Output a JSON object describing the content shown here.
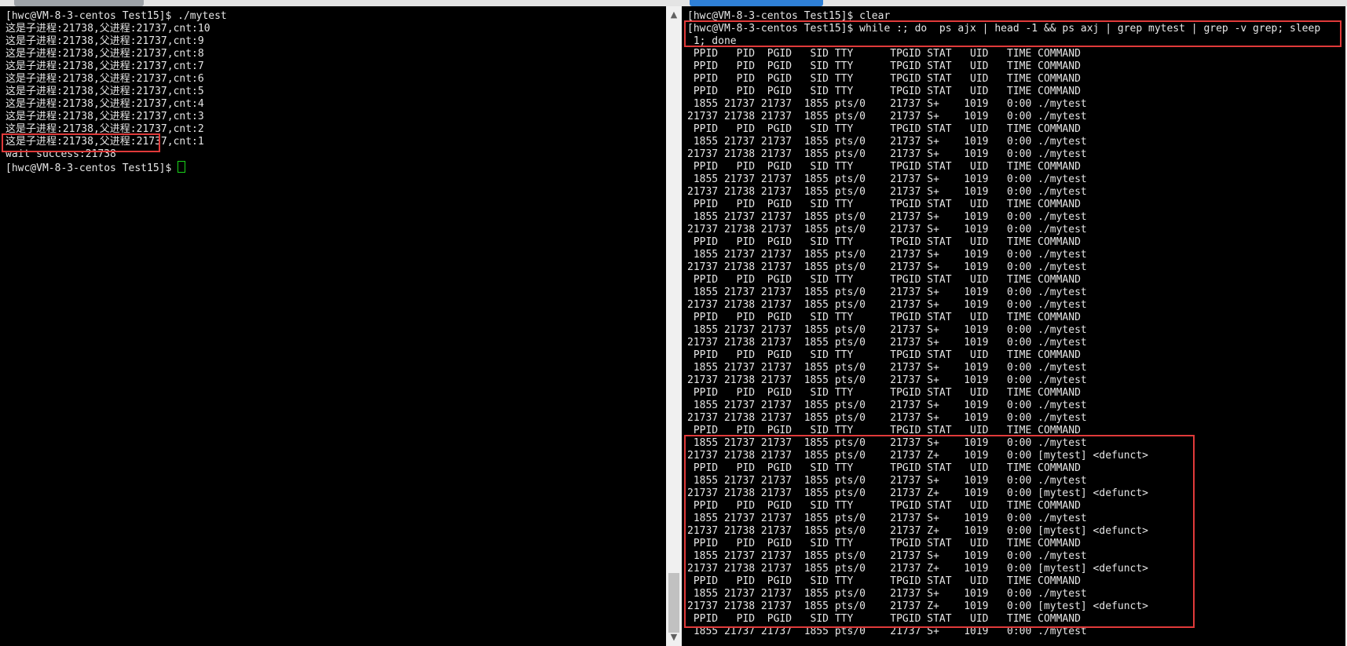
{
  "left_terminal": {
    "lines": [
      "[hwc@VM-8-3-centos Test15]$ ./mytest",
      "这是子进程:21738,父进程:21737,cnt:10",
      "这是子进程:21738,父进程:21737,cnt:9",
      "这是子进程:21738,父进程:21737,cnt:8",
      "这是子进程:21738,父进程:21737,cnt:7",
      "这是子进程:21738,父进程:21737,cnt:6",
      "这是子进程:21738,父进程:21737,cnt:5",
      "这是子进程:21738,父进程:21737,cnt:4",
      "这是子进程:21738,父进程:21737,cnt:3",
      "这是子进程:21738,父进程:21737,cnt:2",
      "这是子进程:21738,父进程:21737,cnt:1",
      "wait success:21738"
    ],
    "prompt": "[hwc@VM-8-3-centos Test15]$ "
  },
  "right_terminal": {
    "lines": [
      "[hwc@VM-8-3-centos Test15]$ clear",
      "[hwc@VM-8-3-centos Test15]$ while :; do  ps ajx | head -1 && ps axj | grep mytest | grep -v grep; sleep",
      " 1; done",
      " PPID   PID  PGID   SID TTY      TPGID STAT   UID   TIME COMMAND",
      " PPID   PID  PGID   SID TTY      TPGID STAT   UID   TIME COMMAND",
      " PPID   PID  PGID   SID TTY      TPGID STAT   UID   TIME COMMAND",
      " PPID   PID  PGID   SID TTY      TPGID STAT   UID   TIME COMMAND",
      " 1855 21737 21737  1855 pts/0    21737 S+    1019   0:00 ./mytest",
      "21737 21738 21737  1855 pts/0    21737 S+    1019   0:00 ./mytest",
      " PPID   PID  PGID   SID TTY      TPGID STAT   UID   TIME COMMAND",
      " 1855 21737 21737  1855 pts/0    21737 S+    1019   0:00 ./mytest",
      "21737 21738 21737  1855 pts/0    21737 S+    1019   0:00 ./mytest",
      " PPID   PID  PGID   SID TTY      TPGID STAT   UID   TIME COMMAND",
      " 1855 21737 21737  1855 pts/0    21737 S+    1019   0:00 ./mytest",
      "21737 21738 21737  1855 pts/0    21737 S+    1019   0:00 ./mytest",
      " PPID   PID  PGID   SID TTY      TPGID STAT   UID   TIME COMMAND",
      " 1855 21737 21737  1855 pts/0    21737 S+    1019   0:00 ./mytest",
      "21737 21738 21737  1855 pts/0    21737 S+    1019   0:00 ./mytest",
      " PPID   PID  PGID   SID TTY      TPGID STAT   UID   TIME COMMAND",
      " 1855 21737 21737  1855 pts/0    21737 S+    1019   0:00 ./mytest",
      "21737 21738 21737  1855 pts/0    21737 S+    1019   0:00 ./mytest",
      " PPID   PID  PGID   SID TTY      TPGID STAT   UID   TIME COMMAND",
      " 1855 21737 21737  1855 pts/0    21737 S+    1019   0:00 ./mytest",
      "21737 21738 21737  1855 pts/0    21737 S+    1019   0:00 ./mytest",
      " PPID   PID  PGID   SID TTY      TPGID STAT   UID   TIME COMMAND",
      " 1855 21737 21737  1855 pts/0    21737 S+    1019   0:00 ./mytest",
      "21737 21738 21737  1855 pts/0    21737 S+    1019   0:00 ./mytest",
      " PPID   PID  PGID   SID TTY      TPGID STAT   UID   TIME COMMAND",
      " 1855 21737 21737  1855 pts/0    21737 S+    1019   0:00 ./mytest",
      "21737 21738 21737  1855 pts/0    21737 S+    1019   0:00 ./mytest",
      " PPID   PID  PGID   SID TTY      TPGID STAT   UID   TIME COMMAND",
      " 1855 21737 21737  1855 pts/0    21737 S+    1019   0:00 ./mytest",
      "21737 21738 21737  1855 pts/0    21737 S+    1019   0:00 ./mytest",
      " PPID   PID  PGID   SID TTY      TPGID STAT   UID   TIME COMMAND",
      " 1855 21737 21737  1855 pts/0    21737 S+    1019   0:00 ./mytest",
      "21737 21738 21737  1855 pts/0    21737 Z+    1019   0:00 [mytest] <defunct>",
      " PPID   PID  PGID   SID TTY      TPGID STAT   UID   TIME COMMAND",
      " 1855 21737 21737  1855 pts/0    21737 S+    1019   0:00 ./mytest",
      "21737 21738 21737  1855 pts/0    21737 Z+    1019   0:00 [mytest] <defunct>",
      " PPID   PID  PGID   SID TTY      TPGID STAT   UID   TIME COMMAND",
      " 1855 21737 21737  1855 pts/0    21737 S+    1019   0:00 ./mytest",
      "21737 21738 21737  1855 pts/0    21737 Z+    1019   0:00 [mytest] <defunct>",
      " PPID   PID  PGID   SID TTY      TPGID STAT   UID   TIME COMMAND",
      " 1855 21737 21737  1855 pts/0    21737 S+    1019   0:00 ./mytest",
      "21737 21738 21737  1855 pts/0    21737 Z+    1019   0:00 [mytest] <defunct>",
      " PPID   PID  PGID   SID TTY      TPGID STAT   UID   TIME COMMAND",
      " 1855 21737 21737  1855 pts/0    21737 S+    1019   0:00 ./mytest",
      "21737 21738 21737  1855 pts/0    21737 Z+    1019   0:00 [mytest] <defunct>",
      " PPID   PID  PGID   SID TTY      TPGID STAT   UID   TIME COMMAND",
      " 1855 21737 21737  1855 pts/0    21737 S+    1019   0:00 ./mytest"
    ]
  },
  "scrollbar": {
    "up_icon": "▲",
    "down_icon": "▼"
  },
  "colors": {
    "background": "#000000",
    "text": "#e6e6e6",
    "highlight": "#e03a3a",
    "cursor": "#19d419",
    "active_tab": "#2f80d6"
  }
}
